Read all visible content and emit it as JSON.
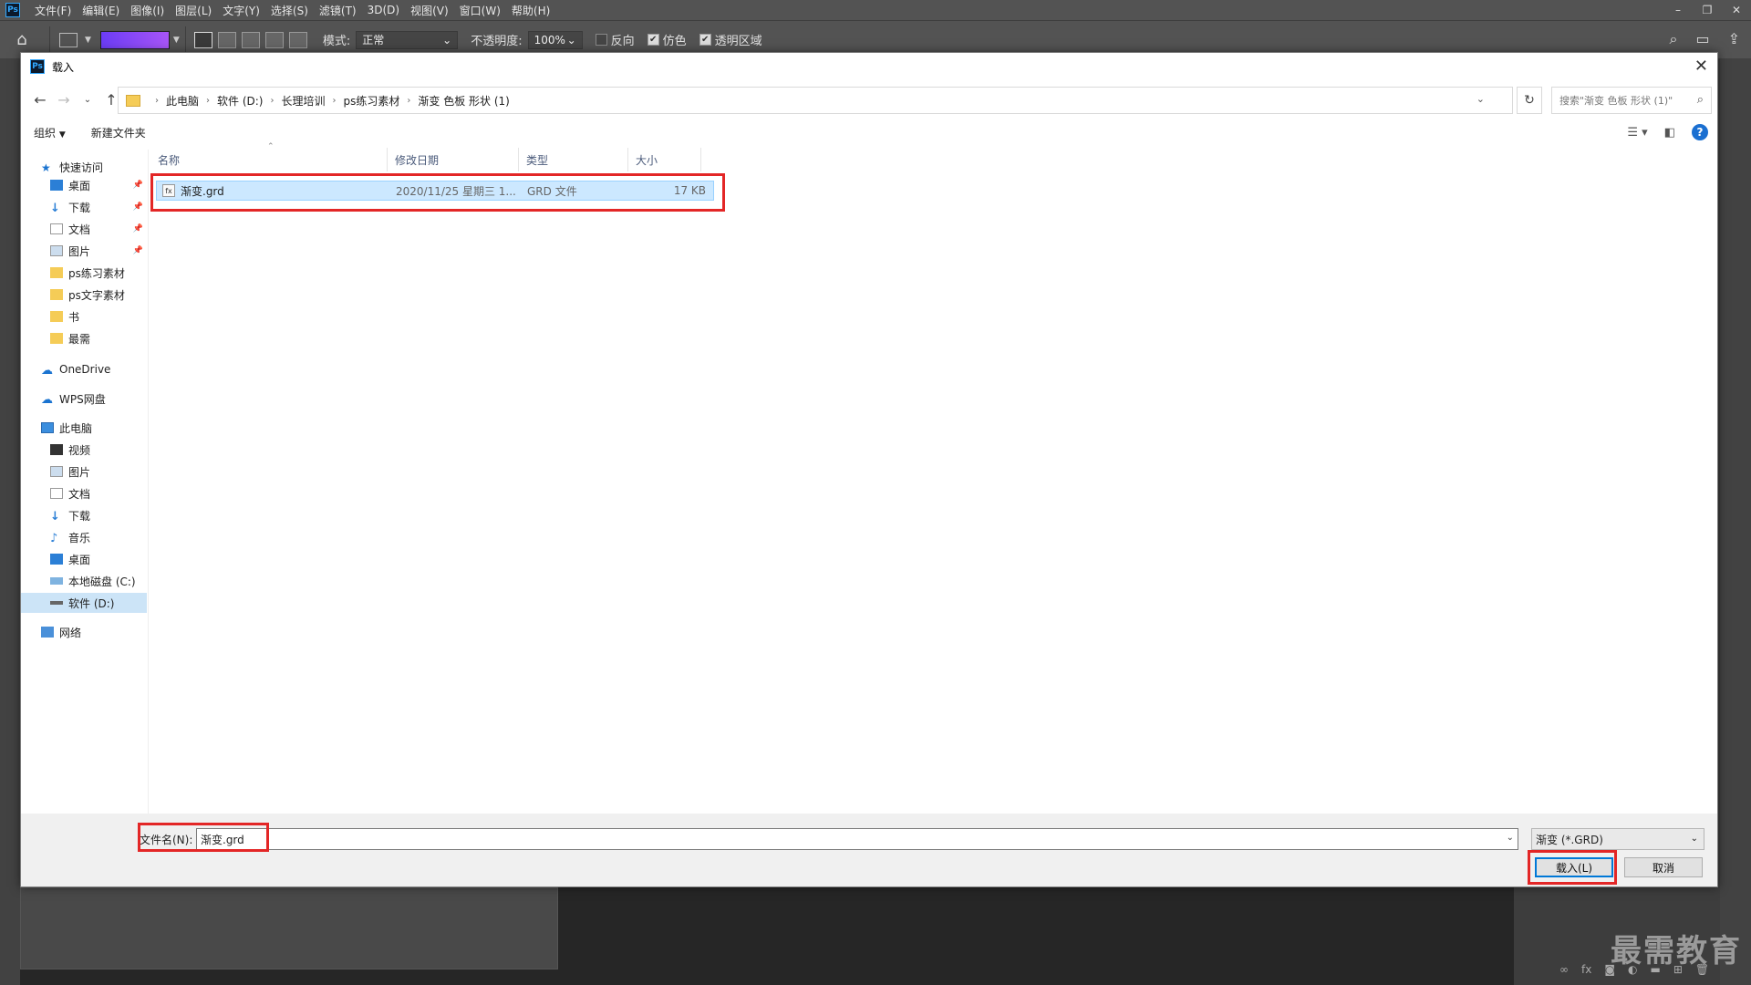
{
  "ps": {
    "logo": "Ps",
    "menu": [
      "文件(F)",
      "编辑(E)",
      "图像(I)",
      "图层(L)",
      "文字(Y)",
      "选择(S)",
      "滤镜(T)",
      "3D(D)",
      "视图(V)",
      "窗口(W)",
      "帮助(H)"
    ],
    "options": {
      "mode_label": "模式:",
      "mode_value": "正常",
      "opacity_label": "不透明度:",
      "opacity_value": "100%",
      "reverse_label": "反向",
      "reverse_checked": false,
      "dither_label": "仿色",
      "dither_checked": true,
      "transparency_label": "透明区域",
      "transparency_checked": true
    },
    "watermark": "最需教育"
  },
  "dialog": {
    "title": "载入",
    "breadcrumbs": [
      "此电脑",
      "软件 (D:)",
      "长理培训",
      "ps练习素材",
      "渐变  色板  形状 (1)"
    ],
    "search_placeholder": "搜索\"渐变  色板  形状 (1)\"",
    "toolbar": {
      "organize": "组织",
      "new_folder": "新建文件夹"
    },
    "nav": {
      "quick_access": "快速访问",
      "quick_items": [
        "桌面",
        "下载",
        "文档",
        "图片",
        "ps练习素材",
        "ps文字素材",
        "书",
        "最需"
      ],
      "onedrive": "OneDrive",
      "wps": "WPS网盘",
      "this_pc": "此电脑",
      "pc_items": [
        "视频",
        "图片",
        "文档",
        "下载",
        "音乐",
        "桌面",
        "本地磁盘 (C:)",
        "软件 (D:)"
      ],
      "network": "网络"
    },
    "columns": [
      "名称",
      "修改日期",
      "类型",
      "大小"
    ],
    "files": [
      {
        "name": "渐变.grd",
        "modified": "2020/11/25 星期三 1...",
        "type": "GRD 文件",
        "size": "17 KB"
      }
    ],
    "filename_label": "文件名(N):",
    "filename_value": "渐变.grd",
    "filetype": "渐变 (*.GRD)",
    "load_button": "载入(L)",
    "cancel_button": "取消"
  }
}
